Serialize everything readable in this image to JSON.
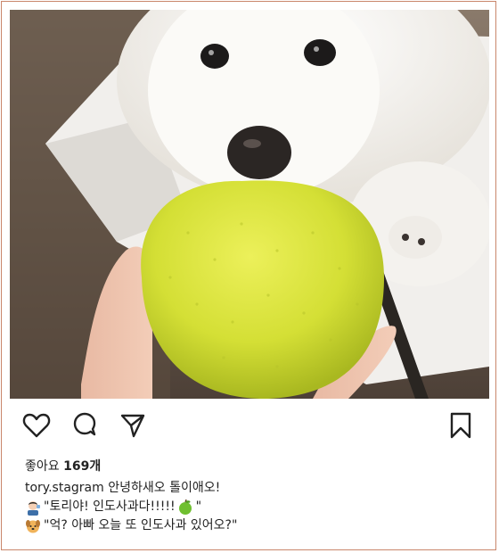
{
  "post": {
    "likes_label": "좋아요",
    "likes_count": "169개",
    "username": "tory.stagram",
    "caption_text": "안녕하새오 톨이애오!",
    "line2_text": "\"토리야! 인도사과다!!!!! ",
    "line2_end": "\"",
    "line3_text": "\"억? 아빠 오늘 또 인도사과 있어오?\""
  },
  "icons": {
    "like": "heart-icon",
    "comment": "comment-icon",
    "share": "send-icon",
    "save": "bookmark-icon"
  },
  "colors": {
    "frame_border": "#c9866b",
    "apple": "#d6e23a",
    "text": "#222222"
  }
}
